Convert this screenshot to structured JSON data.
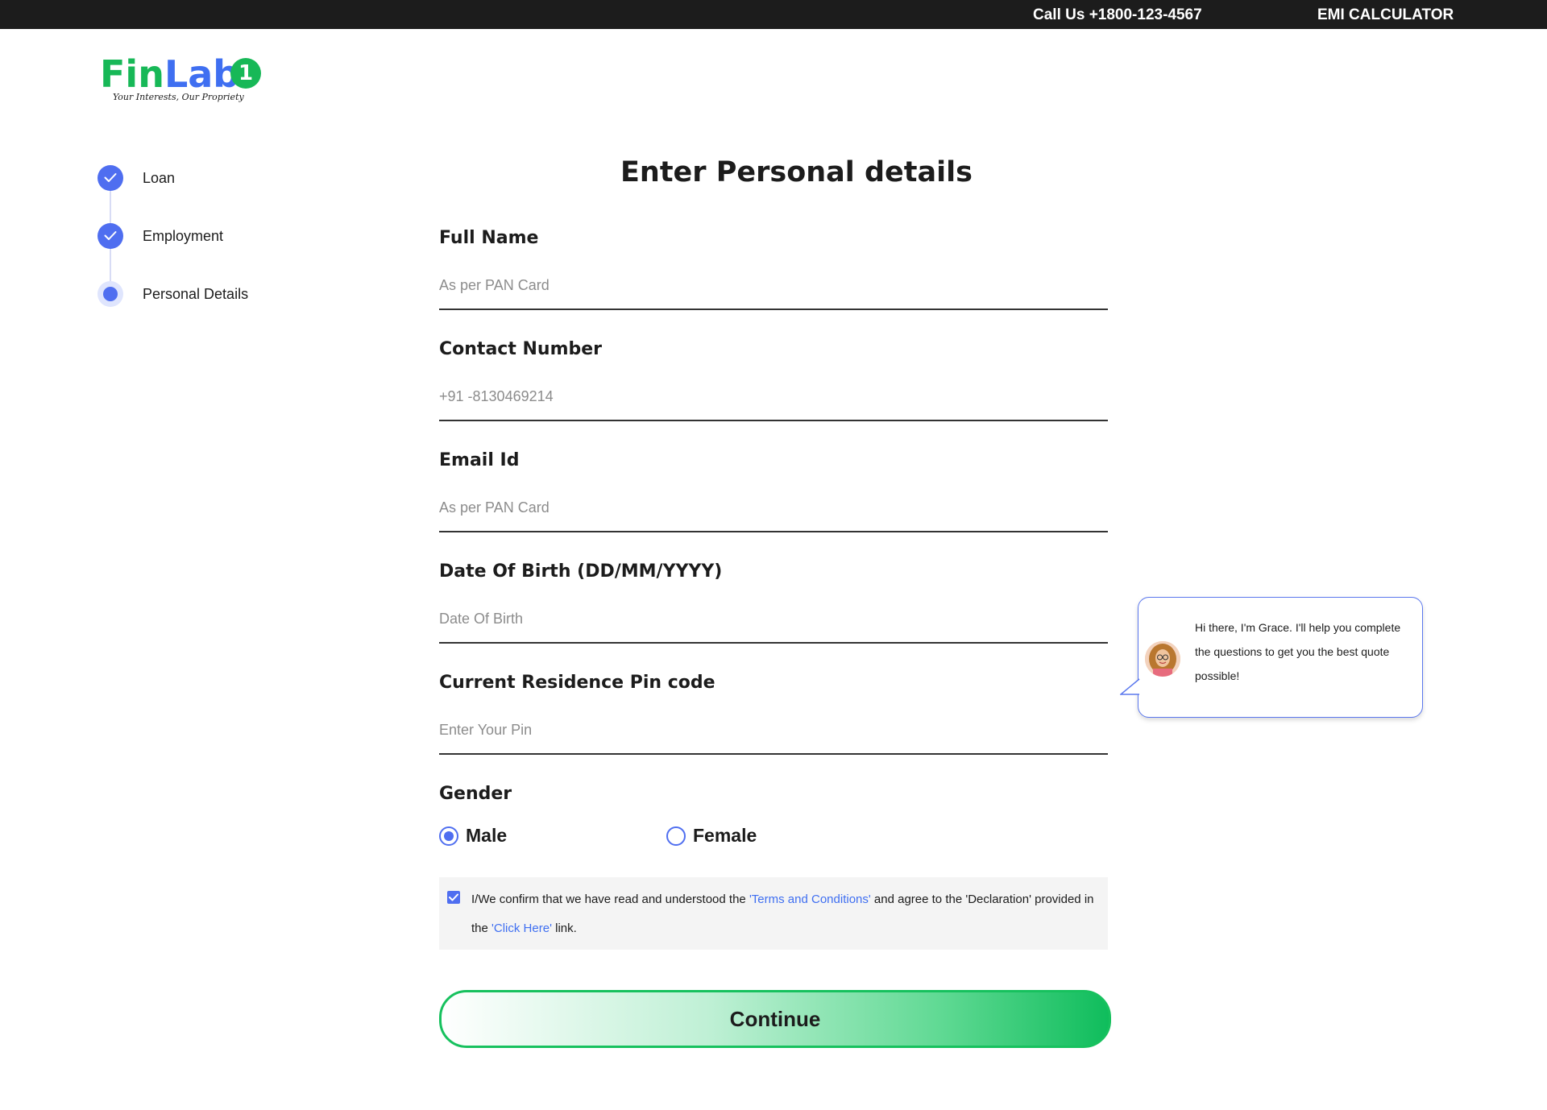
{
  "topbar": {
    "call": "Call Us +1800-123-4567",
    "emi": "EMI CALCULATOR"
  },
  "logo": {
    "fin": "Fin",
    "lab": "Lab",
    "one": "1",
    "tagline": "Your Interests, Our Propriety"
  },
  "steps": [
    {
      "label": "Loan",
      "status": "done"
    },
    {
      "label": "Employment",
      "status": "done"
    },
    {
      "label": "Personal Details",
      "status": "current"
    }
  ],
  "form": {
    "title": "Enter Personal details",
    "full_name": {
      "label": "Full Name",
      "placeholder": "As per PAN Card"
    },
    "contact": {
      "label": "Contact Number",
      "placeholder": "+91 -8130469214"
    },
    "email": {
      "label": "Email Id",
      "placeholder": "As per PAN Card"
    },
    "dob": {
      "label": "Date Of Birth (DD/MM/YYYY)",
      "placeholder": "Date Of Birth"
    },
    "pin": {
      "label": "Current Residence Pin code",
      "placeholder": "Enter Your Pin"
    },
    "gender": {
      "label": "Gender",
      "options": [
        "Male",
        "Female"
      ],
      "selected": "Male"
    },
    "consent": {
      "checked": true,
      "text_1": "I/We confirm that we have read and understood the ",
      "terms_link": "'Terms and Conditions'",
      "text_2": " and agree to the 'Declaration' provided in the ",
      "click_link": "'Click Here'",
      "text_3": " link."
    },
    "continue_label": "Continue"
  },
  "chat": {
    "message": "Hi there, I'm Grace. I'll help you complete the questions to get you the best quote possible!"
  },
  "colors": {
    "accent_blue": "#4f6ef0",
    "brand_green": "#17b857",
    "topbar": "#1c1c1c"
  }
}
